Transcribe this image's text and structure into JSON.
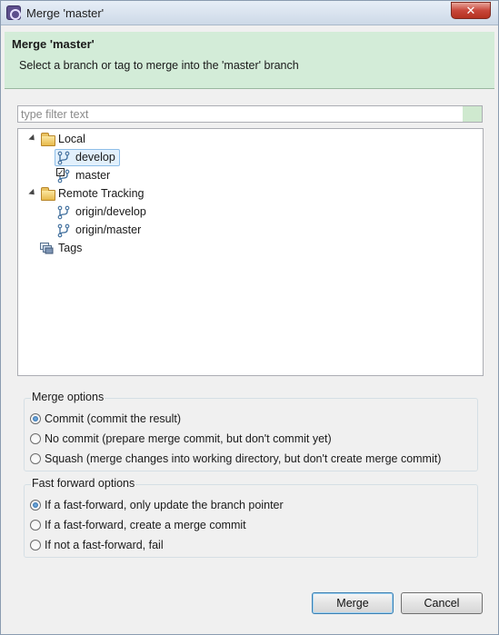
{
  "window": {
    "title": "Merge 'master'",
    "close_glyph": "✕"
  },
  "banner": {
    "title": "Merge 'master'",
    "message": "Select a branch or tag to merge into the 'master' branch",
    "bg_color": "#d3ecd8"
  },
  "filter": {
    "placeholder": "type filter text",
    "value": ""
  },
  "tree": {
    "local": {
      "label": "Local",
      "icon": "folder-open-icon",
      "children": [
        {
          "label": "develop",
          "icon": "branch-icon",
          "selected": true
        },
        {
          "label": "master",
          "icon": "branch-icon",
          "checked_out": true
        }
      ]
    },
    "remote": {
      "label": "Remote Tracking",
      "icon": "folder-open-icon",
      "children": [
        {
          "label": "origin/develop",
          "icon": "branch-icon"
        },
        {
          "label": "origin/master",
          "icon": "branch-icon"
        }
      ]
    },
    "tags": {
      "label": "Tags",
      "icon": "tags-icon"
    }
  },
  "merge_options": {
    "title": "Merge options",
    "options": [
      {
        "label": "Commit (commit the result)",
        "checked": true
      },
      {
        "label": "No commit (prepare merge commit, but don't commit yet)",
        "checked": false
      },
      {
        "label": "Squash (merge changes into working directory, but don't create merge commit)",
        "checked": false
      }
    ]
  },
  "ff_options": {
    "title": "Fast forward options",
    "options": [
      {
        "label": "If a fast-forward, only update the branch pointer",
        "checked": true
      },
      {
        "label": "If a fast-forward, create a merge commit",
        "checked": false
      },
      {
        "label": "If not a fast-forward, fail",
        "checked": false
      }
    ]
  },
  "buttons": {
    "merge": "Merge",
    "cancel": "Cancel"
  }
}
